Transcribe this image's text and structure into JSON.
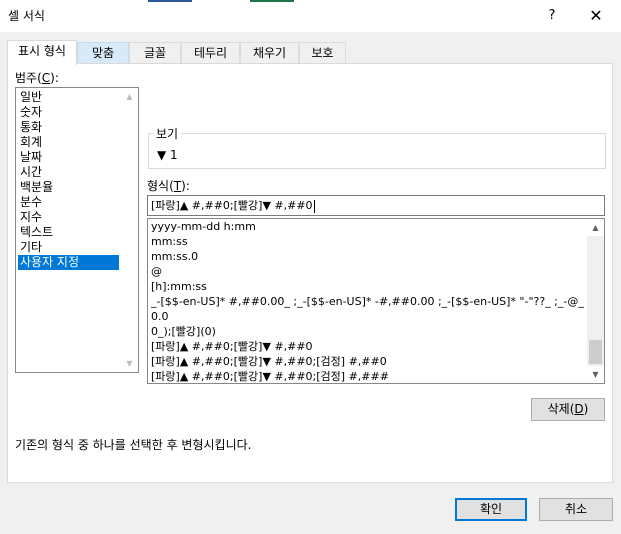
{
  "window": {
    "title": "셀 서식",
    "help_label": "?",
    "close_label": "✕",
    "accent_strip_colors": [
      "#2b579a",
      "#217346",
      "#2b579a",
      "#217346"
    ]
  },
  "tabs": [
    {
      "label": "표시 형식",
      "active": true
    },
    {
      "label": "맞춤",
      "active": false,
      "hover": true
    },
    {
      "label": "글꼴",
      "active": false
    },
    {
      "label": "테두리",
      "active": false
    },
    {
      "label": "채우기",
      "active": false
    },
    {
      "label": "보호",
      "active": false
    }
  ],
  "category": {
    "label_prefix": "범주(",
    "label_key": "C",
    "label_suffix": "):",
    "items": [
      "일반",
      "숫자",
      "통화",
      "회계",
      "날짜",
      "시간",
      "백분율",
      "분수",
      "지수",
      "텍스트",
      "기타",
      "사용자 지정"
    ],
    "selected": "사용자 지정"
  },
  "sample": {
    "legend": "보기",
    "value": "▼ 1"
  },
  "format": {
    "label_prefix": "형식(",
    "label_key": "T",
    "label_suffix": "):",
    "input_value": "[파랑]▲ #,##0;[빨강]▼ #,##0",
    "list_items": [
      "yyyy-mm-dd h:mm",
      "mm:ss",
      "mm:ss.0",
      "@",
      "[h]:mm:ss",
      "_-[$$-en-US]* #,##0.00_ ;_-[$$-en-US]* -#,##0.00 ;_-[$$-en-US]* \"-\"??_ ;_-@_",
      "0.0",
      "0_);[빨강](0)",
      "[파랑]▲ #,##0;[빨강]▼ #,##0",
      "[파랑]▲ #,##0;[빨강]▼ #,##0;[검정] #,##0",
      "[파랑]▲ #,##0;[빨강]▼ #,##0;[검정] #,###"
    ]
  },
  "buttons": {
    "delete_prefix": "삭제(",
    "delete_key": "D",
    "delete_suffix": ")",
    "ok": "확인",
    "cancel": "취소"
  },
  "hint": "기존의 형식 중 하나를 선택한 후 변형시킵니다.",
  "colors": {
    "selection": "#0078d7",
    "dialog_bg": "#f0f0f0",
    "tab_hover": "#d8eaf9"
  }
}
